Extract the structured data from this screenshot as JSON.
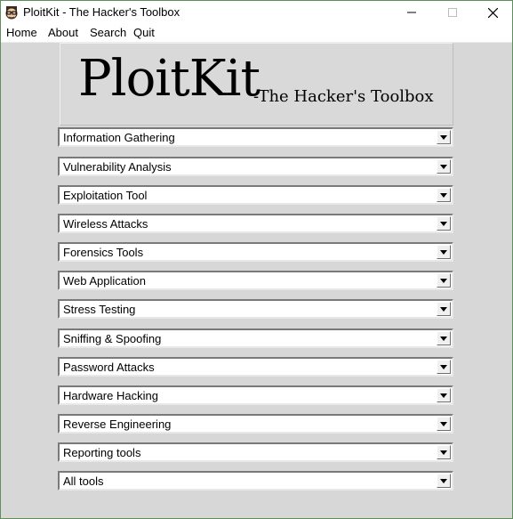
{
  "window": {
    "title": "PloitKit - The Hacker's Toolbox"
  },
  "menu": [
    "Home",
    "About",
    "Search",
    "Quit"
  ],
  "banner": {
    "title": "PloitKit",
    "subtitle": "-The Hacker's Toolbox"
  },
  "categories": [
    "Information Gathering",
    "Vulnerability Analysis",
    "Exploitation Tool",
    "Wireless Attacks",
    "Forensics Tools",
    "Web Application",
    "Stress Testing",
    "Sniffing & Spoofing",
    "Password Attacks",
    "Hardware Hacking",
    "Reverse Engineering",
    "Reporting tools",
    "All tools"
  ]
}
